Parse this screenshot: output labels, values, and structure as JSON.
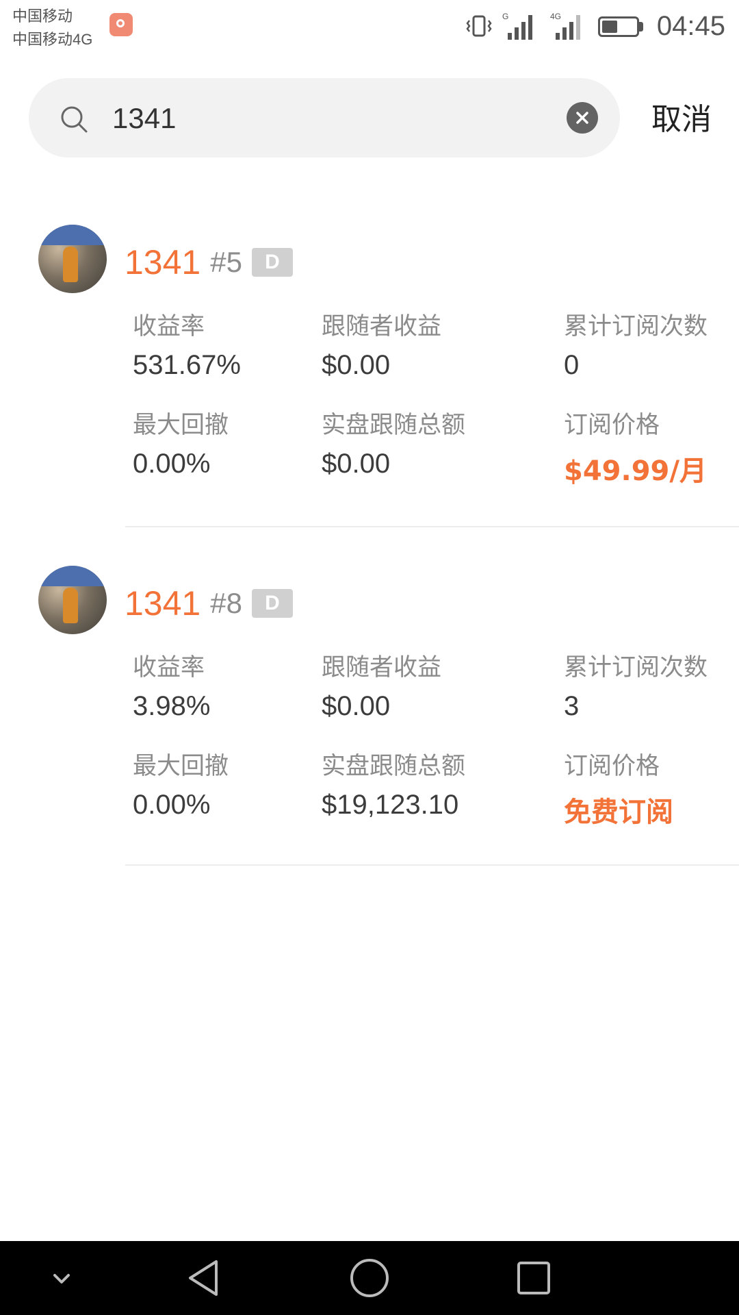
{
  "status_bar": {
    "carrier_line1": "中国移动",
    "carrier_line2": "中国移动4G",
    "time": "04:45",
    "icons": [
      "app-notification-icon",
      "vibrate-icon",
      "signal-icon",
      "signal-4g-icon",
      "battery-icon"
    ]
  },
  "search": {
    "query": "1341",
    "cancel_label": "取消"
  },
  "results": [
    {
      "name": "1341",
      "rank": "#5",
      "badge": "D",
      "stats": {
        "return_label": "收益率",
        "return_value": "531.67%",
        "follower_profit_label": "跟随者收益",
        "follower_profit_value": "$0.00",
        "subscriptions_label": "累计订阅次数",
        "subscriptions_value": "0",
        "max_drawdown_label": "最大回撤",
        "max_drawdown_value": "0.00%",
        "live_follow_label": "实盘跟随总额",
        "live_follow_value": "$0.00",
        "price_label": "订阅价格",
        "price_value": "$49.99/月"
      }
    },
    {
      "name": "1341",
      "rank": "#8",
      "badge": "D",
      "stats": {
        "return_label": "收益率",
        "return_value": "3.98%",
        "follower_profit_label": "跟随者收益",
        "follower_profit_value": "$0.00",
        "subscriptions_label": "累计订阅次数",
        "subscriptions_value": "3",
        "max_drawdown_label": "最大回撤",
        "max_drawdown_value": "0.00%",
        "live_follow_label": "实盘跟随总额",
        "live_follow_value": "$19,123.10",
        "price_label": "订阅价格",
        "price_value": "免费订阅"
      }
    }
  ],
  "colors": {
    "accent": "#f27238",
    "label": "#8b8b8b",
    "value": "#3c3c3c",
    "search_bg": "#f2f2f2",
    "nav_bar": "#000000"
  }
}
